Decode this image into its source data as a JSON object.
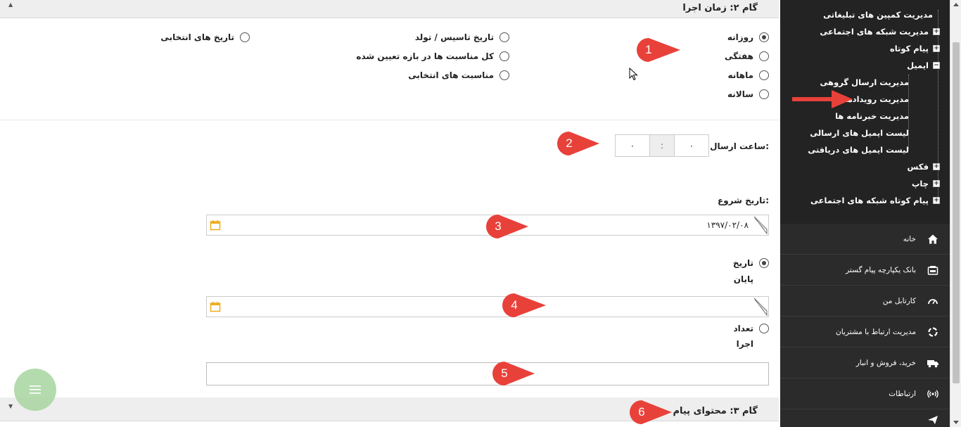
{
  "step2": {
    "title": "گام ۲: زمان اجرا"
  },
  "frequency": {
    "col1": [
      {
        "label": "روزانه",
        "checked": true
      },
      {
        "label": "هفتگی",
        "checked": false
      },
      {
        "label": "ماهانه",
        "checked": false
      },
      {
        "label": "سالانه",
        "checked": false
      }
    ],
    "col2": [
      {
        "label": "تاریخ تاسیس / تولد",
        "checked": false
      },
      {
        "label": "کل مناسبت ها در بازه تعیین شده",
        "checked": false
      },
      {
        "label": "مناسبت های انتخابی",
        "checked": false
      }
    ],
    "col3": [
      {
        "label": "تاریخ های انتخابی",
        "checked": false
      }
    ]
  },
  "send_time": {
    "label": "ساعت ارسال:",
    "hour": "۰",
    "minute": "۰",
    "separator": ":"
  },
  "start_date": {
    "label": "تاریخ شروع:",
    "value": "۱۳۹۷/۰۲/۰۸"
  },
  "end_date": {
    "label_line1": "تاریخ",
    "label_line2": "پایان",
    "checked": true,
    "value": ""
  },
  "count": {
    "label_line1": "تعداد",
    "label_line2": "اجرا",
    "checked": false,
    "value": ""
  },
  "step3": {
    "title": "گام ۳: محتوای پیام"
  },
  "callouts": [
    "1",
    "2",
    "3",
    "4",
    "5",
    "6"
  ],
  "callout_color": "#e8413a",
  "sidebar": {
    "tree": [
      {
        "label": "مدیریت کمپین های تبلیغاتی",
        "level": 0,
        "expander": "none"
      },
      {
        "label": "مدیریت شبکه های اجتماعی",
        "level": 0,
        "expander": "+"
      },
      {
        "label": "پیام کوتاه",
        "level": 0,
        "expander": "+"
      },
      {
        "label": "ایمیل",
        "level": 0,
        "expander": "−"
      },
      {
        "label": "مدیریت ارسال گروهی",
        "level": 1,
        "expander": "none"
      },
      {
        "label": "مدیریت رویدادها",
        "level": 1,
        "expander": "none"
      },
      {
        "label": "مدیریت خبرنامه ها",
        "level": 1,
        "expander": "none"
      },
      {
        "label": "لیست ایمیل های ارسالی",
        "level": 1,
        "expander": "none"
      },
      {
        "label": "لیست ایمیل های دریافتی",
        "level": 1,
        "expander": "none"
      },
      {
        "label": "فکس",
        "level": 0,
        "expander": "+"
      },
      {
        "label": "چاپ",
        "level": 0,
        "expander": "+"
      },
      {
        "label": "پیام کوتاه شبکه های اجتماعی",
        "level": 0,
        "expander": "+"
      }
    ],
    "menu": [
      {
        "label": "خانه",
        "icon": "home-icon"
      },
      {
        "label": "بانک یکپارچه پیام گستر",
        "icon": "bank-icon"
      },
      {
        "label": "کارتابل من",
        "icon": "dashboard-icon"
      },
      {
        "label": "مدیریت ارتباط با مشتریان",
        "icon": "crm-icon"
      },
      {
        "label": "خرید، فروش و انبار",
        "icon": "truck-icon"
      },
      {
        "label": "ارتباطات",
        "icon": "broadcast-icon"
      }
    ]
  },
  "colors": {
    "sidebar_bg": "#232323",
    "header_bg": "#eeeeee",
    "calendar_icon": "#f0ad1e",
    "fab": "#a8d5a0"
  }
}
